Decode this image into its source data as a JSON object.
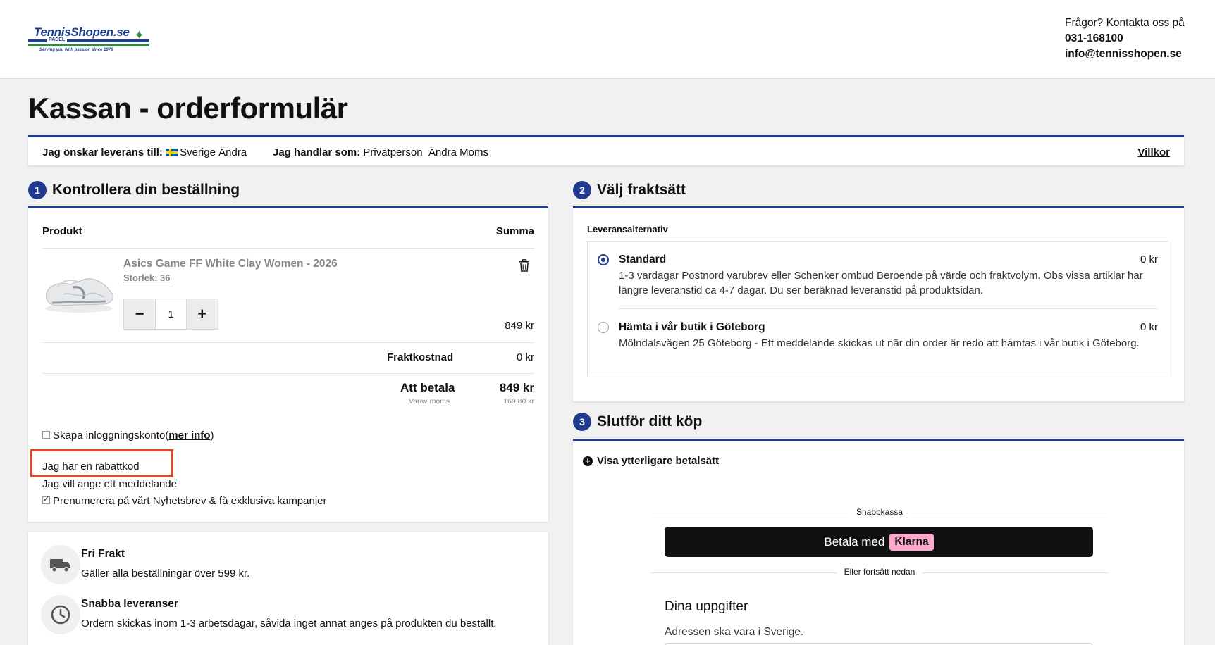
{
  "header": {
    "logo": {
      "name": "TennisShopen.se",
      "sub": "PADEL",
      "tagline": "Serving you with passion since 1976"
    },
    "contact": {
      "prompt": "Frågor? Kontakta oss på",
      "phone": "031-168100",
      "email": "info@tennisshopen.se"
    }
  },
  "page_title": "Kassan - orderformulär",
  "info_bar": {
    "delivery_label": "Jag önskar leverans till:",
    "delivery_country": "Sverige",
    "delivery_change": "Ändra",
    "buyer_label": "Jag handlar som:",
    "buyer_type": "Privatperson",
    "buyer_change": "Ändra Moms",
    "terms": "Villkor"
  },
  "steps": {
    "s1": {
      "num": "1",
      "title": "Kontrollera din beställning"
    },
    "s2": {
      "num": "2",
      "title": "Välj fraktsätt"
    },
    "s3": {
      "num": "3",
      "title": "Slutför ditt köp"
    }
  },
  "order": {
    "col_product": "Produkt",
    "col_sum": "Summa",
    "product_name": "Asics Game FF White Clay Women - 2026",
    "product_size": "Storlek: 36",
    "quantity": "1",
    "minus": "−",
    "plus": "+",
    "price": "849 kr",
    "shipping_label": "Fraktkostnad",
    "shipping_value": "0 kr",
    "total_label": "Att betala",
    "total_value": "849 kr",
    "vat_label": "Varav moms",
    "vat_value": "169,80 kr"
  },
  "options": {
    "create_account": "Skapa inloggningskonto",
    "more_info_open": "(",
    "more_info": "mer info",
    "more_info_close": ")",
    "discount": "Jag har en rabattkod",
    "message": "Jag vill ange ett meddelande",
    "newsletter": "Prenumerera på vårt Nyhetsbrev & få exklusiva kampanjer"
  },
  "usps": [
    {
      "title": "Fri Frakt",
      "text": "Gäller alla beställningar över 599 kr.",
      "icon": "truck-icon"
    },
    {
      "title": "Snabba leveranser",
      "text": "Ordern skickas inom 1-3 arbetsdagar, såvida inget annat anges på produkten du beställt.",
      "icon": "clock-icon"
    }
  ],
  "shipping": {
    "label": "Leveransalternativ",
    "options": [
      {
        "name": "Standard",
        "price": "0 kr",
        "desc": "1-3 vardagar Postnord varubrev eller Schenker ombud Beroende på värde och fraktvolym. Obs vissa artiklar har längre leveranstid ca 4-7 dagar. Du ser beräknad leveranstid på produktsidan.",
        "selected": true
      },
      {
        "name": "Hämta i vår butik i Göteborg",
        "price": "0 kr",
        "desc": "Mölndalsvägen 25 Göteborg - Ett meddelande skickas ut när din order är redo att hämtas i vår butik i Göteborg.",
        "selected": false
      }
    ]
  },
  "payment": {
    "more_methods": "Visa ytterligare betalsätt",
    "quick_label": "Snabbkassa",
    "pay_with": "Betala med",
    "klarna": "Klarna",
    "or_continue": "Eller fortsätt nedan",
    "details_title": "Dina uppgifter",
    "address_note": "Adressen ska vara i Sverige."
  },
  "colors": {
    "accent": "#1f3a8f",
    "highlight": "#e0472a",
    "klarna_pink": "#ffa8cd"
  }
}
